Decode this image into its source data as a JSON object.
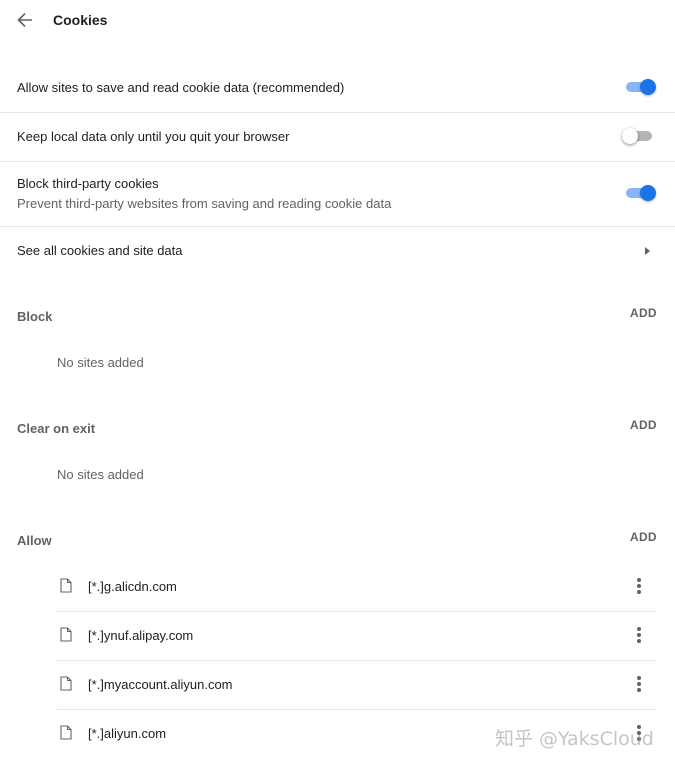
{
  "header": {
    "back_icon": "arrow-back-icon",
    "title": "Cookies"
  },
  "settings": [
    {
      "label": "Allow sites to save and read cookie data (recommended)",
      "enabled": true
    },
    {
      "label": "Keep local data only until you quit your browser",
      "enabled": false
    },
    {
      "label": "Block third-party cookies",
      "sublabel": "Prevent third-party websites from saving and reading cookie data",
      "enabled": true
    },
    {
      "label": "See all cookies and site data",
      "icon": "chevron-right-icon"
    }
  ],
  "sections": {
    "block": {
      "title": "Block",
      "add_label": "ADD",
      "empty_text": "No sites added"
    },
    "clear_on_exit": {
      "title": "Clear on exit",
      "add_label": "ADD",
      "empty_text": "No sites added"
    },
    "allow": {
      "title": "Allow",
      "add_label": "ADD",
      "sites": [
        {
          "name": "[*.]g.alicdn.com",
          "icon": "file-icon"
        },
        {
          "name": "[*.]ynuf.alipay.com",
          "icon": "file-icon"
        },
        {
          "name": "[*.]myaccount.aliyun.com",
          "icon": "file-icon"
        },
        {
          "name": "[*.]aliyun.com",
          "icon": "file-icon"
        }
      ]
    }
  },
  "watermark": "知乎 @YaksCloud",
  "colors": {
    "accent": "#1a73e8",
    "accent_track": "#8ab4f8",
    "text_primary": "#202124",
    "text_secondary": "#5f6368",
    "divider": "#e6e6e6"
  }
}
